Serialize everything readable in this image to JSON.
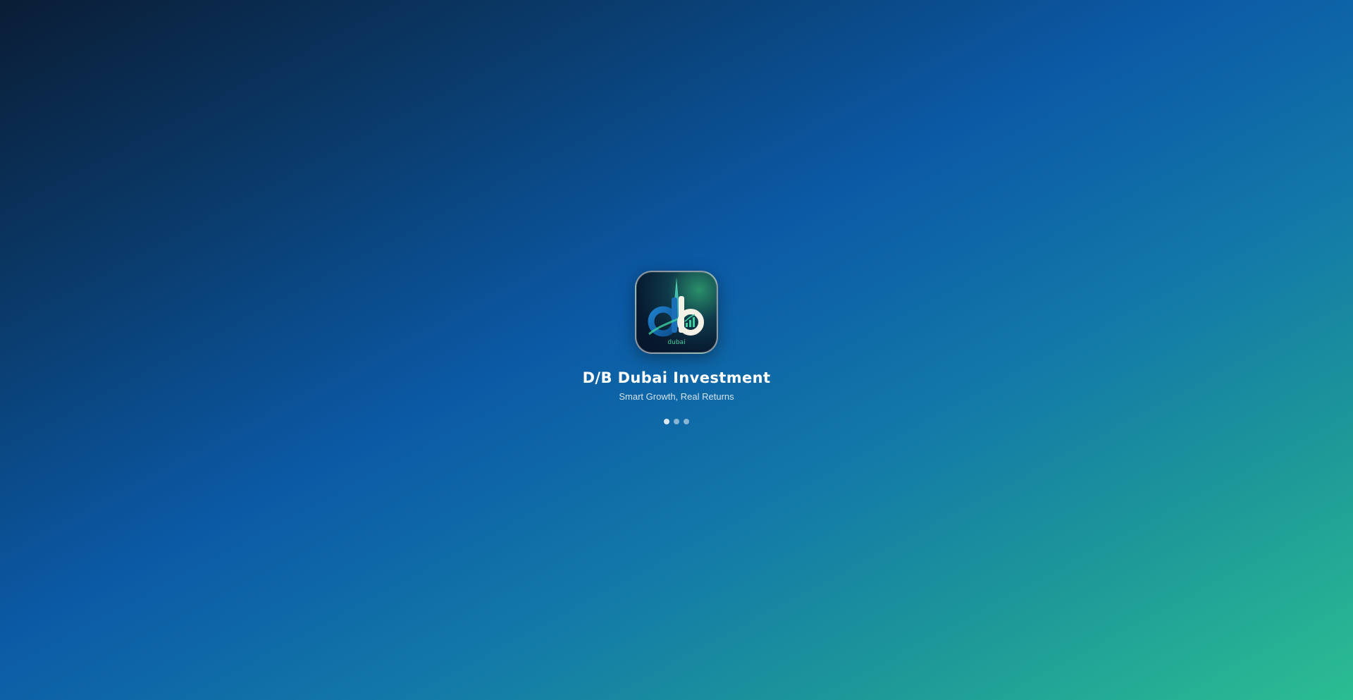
{
  "splash": {
    "app_name": "D/B Dubai Investment",
    "tagline": "Smart Growth, Real Returns",
    "logo_wordmark": "dubai",
    "loader": {
      "dot_count": 3,
      "active_index": 0
    }
  },
  "colors": {
    "background_start": "#0a1d35",
    "background_mid": "#0b5aa6",
    "background_end": "#2bbd92",
    "logo_accent": "#3fd0a0",
    "text": "#ffffff"
  }
}
